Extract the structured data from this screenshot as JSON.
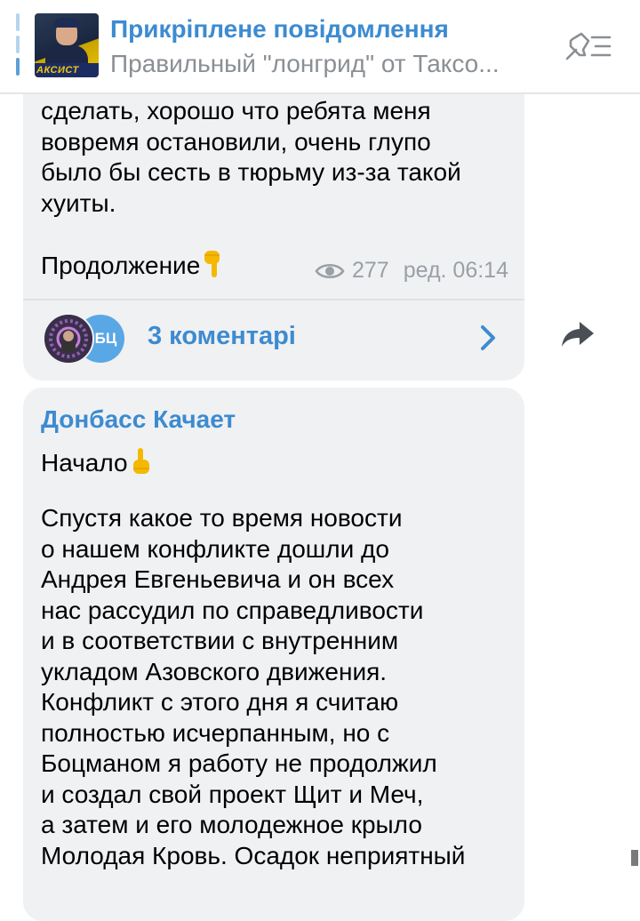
{
  "pinned": {
    "title": "Прикріплене повідомлення",
    "subtitle": "Правильный \"лонгрид\" от Таксо...",
    "thumb_caption": "АКСИСТ",
    "list_icon": "pin-list-icon"
  },
  "message1": {
    "text": "сделать, хорошо что ребята меня\nвовремя остановили, очень глупо\nбыло бы сесть в тюрьму из-за такой\nхуиты.",
    "continuation": "Продолжение",
    "continuation_emoji": "hand-pointing-down",
    "views": "277",
    "time": "ред. 06:14",
    "comments": {
      "avatar2_text": "БЦ",
      "label": "3 коментарі"
    }
  },
  "message2": {
    "author": "Донбасс Качает",
    "start": "Начало",
    "start_emoji": "hand-pointing-up",
    "text": "Спустя какое то время новости\nо нашем конфликте дошли до\nАндрея Евгеньевича и он всех\nнас рассудил по справедливости\nи в соответствии с внутренним\nукладом Азовского движения.\nКонфликт с этого дня я считаю\nполностью исчерпанным, но с\nБоцманом я работу не продолжил\nи создал свой проект Щит и Меч,\nа затем и его молодежное крыло\nМолодая Кровь. Осадок неприятный"
  },
  "colors": {
    "accent": "#3d8bd0",
    "bubble": "#f0f1f3",
    "meta": "#9aa0a6"
  }
}
